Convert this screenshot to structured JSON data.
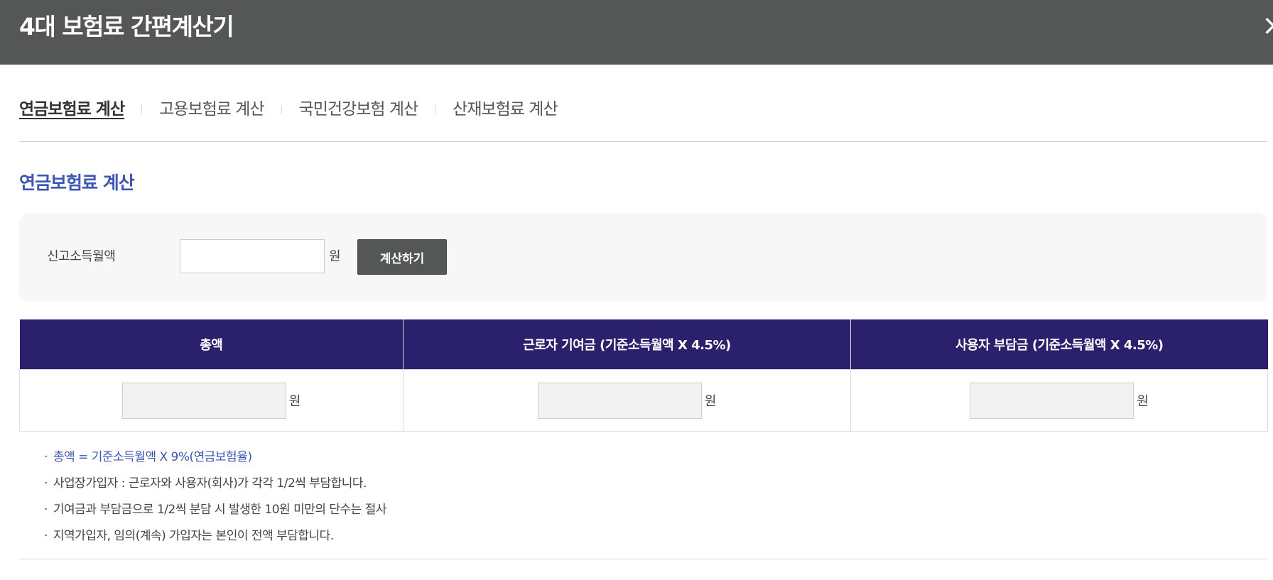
{
  "header": {
    "title": "4대 보험료 간편계산기",
    "close_glyph": "×"
  },
  "tabs": [
    {
      "label": "연금보험료 계산",
      "active": true
    },
    {
      "label": "고용보험료 계산",
      "active": false
    },
    {
      "label": "국민건강보험 계산",
      "active": false
    },
    {
      "label": "산재보험료 계산",
      "active": false
    }
  ],
  "section": {
    "title": "연금보험료 계산"
  },
  "form": {
    "label": "신고소득월액",
    "value": "",
    "placeholder": "",
    "unit": "원",
    "button_label": "계산하기"
  },
  "table": {
    "headers": [
      "총액",
      "근로자 기여금 (기준소득월액 X 4.5%)",
      "사용자 부담금 (기준소득월액 X 4.5%)"
    ],
    "values": [
      "",
      "",
      ""
    ],
    "unit": "원"
  },
  "notes": [
    "총액 = 기준소득월액 X 9%(연금보험율)",
    "사업장가입자 : 근로자와 사용자(회사)가 각각 1/2씩 부담합니다.",
    "기여금과 부담금으로 1/2씩 분담 시 발생한 10원 미만의 단수는 절사",
    "지역가입자, 임의(계속) 가입자는 본인이 전액 부담합니다."
  ],
  "colors": {
    "header_bg": "#555756",
    "accent_blue": "#3d55b3",
    "table_header_bg": "#2a206b"
  },
  "icons": {
    "close": "close-icon"
  }
}
